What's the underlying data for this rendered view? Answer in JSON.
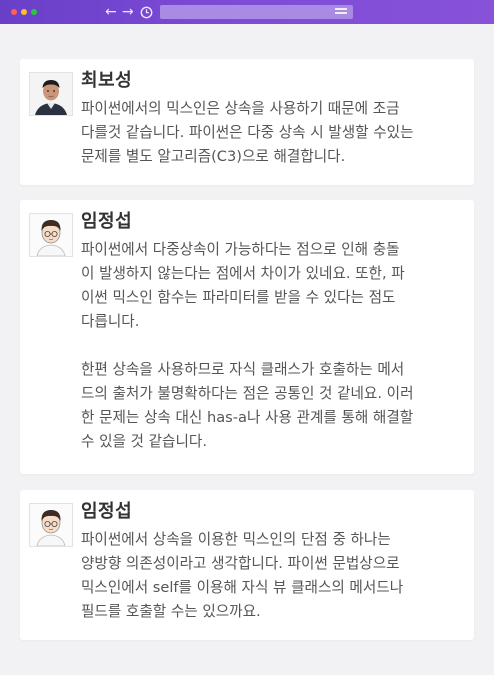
{
  "browser": {
    "controls": [
      "close",
      "minimize",
      "maximize"
    ],
    "nav_icons": [
      "back-arrow-icon",
      "forward-arrow-icon",
      "history-icon"
    ],
    "url_value": "",
    "url_icon": "sliders-icon",
    "accent_color": "#7a47d4"
  },
  "comments": [
    {
      "author": "최보성",
      "avatar": "avatar-photo",
      "text": "파이썬에서의 믹스인은 상속을 사용하기 때문에 조금\n다를것 같습니다. 파이썬은 다중 상속 시 발생할 수있는\n문제를 별도 알고리즘(C3)으로 해결합니다."
    },
    {
      "author": "임정섭",
      "avatar": "avatar-cartoon",
      "text": "파이썬에서 다중상속이 가능하다는 점으로 인해 충돌\n이 발생하지 않는다는 점에서 차이가 있네요. 또한, 파\n이썬 믹스인 함수는 파라미터를 받을 수 있다는 점도\n다릅니다.\n\n한편 상속을 사용하므로 자식 클래스가 호출하는 메서\n드의 출처가 불명확하다는 점은 공통인 것 같네요. 이러\n한 문제는 상속 대신 has-a나 사용 관계를 통해 해결할\n수 있을 것 같습니다."
    },
    {
      "author": "임정섭",
      "avatar": "avatar-cartoon",
      "text": "파이썬에서 상속을 이용한 믹스인의 단점 중 하나는\n양방향 의존성이라고 생각합니다. 파이썬 문법상으로\n믹스인에서 self를 이용해 자식 뷰 클래스의 메서드나\n필드를 호출할 수는 있으까요."
    }
  ]
}
